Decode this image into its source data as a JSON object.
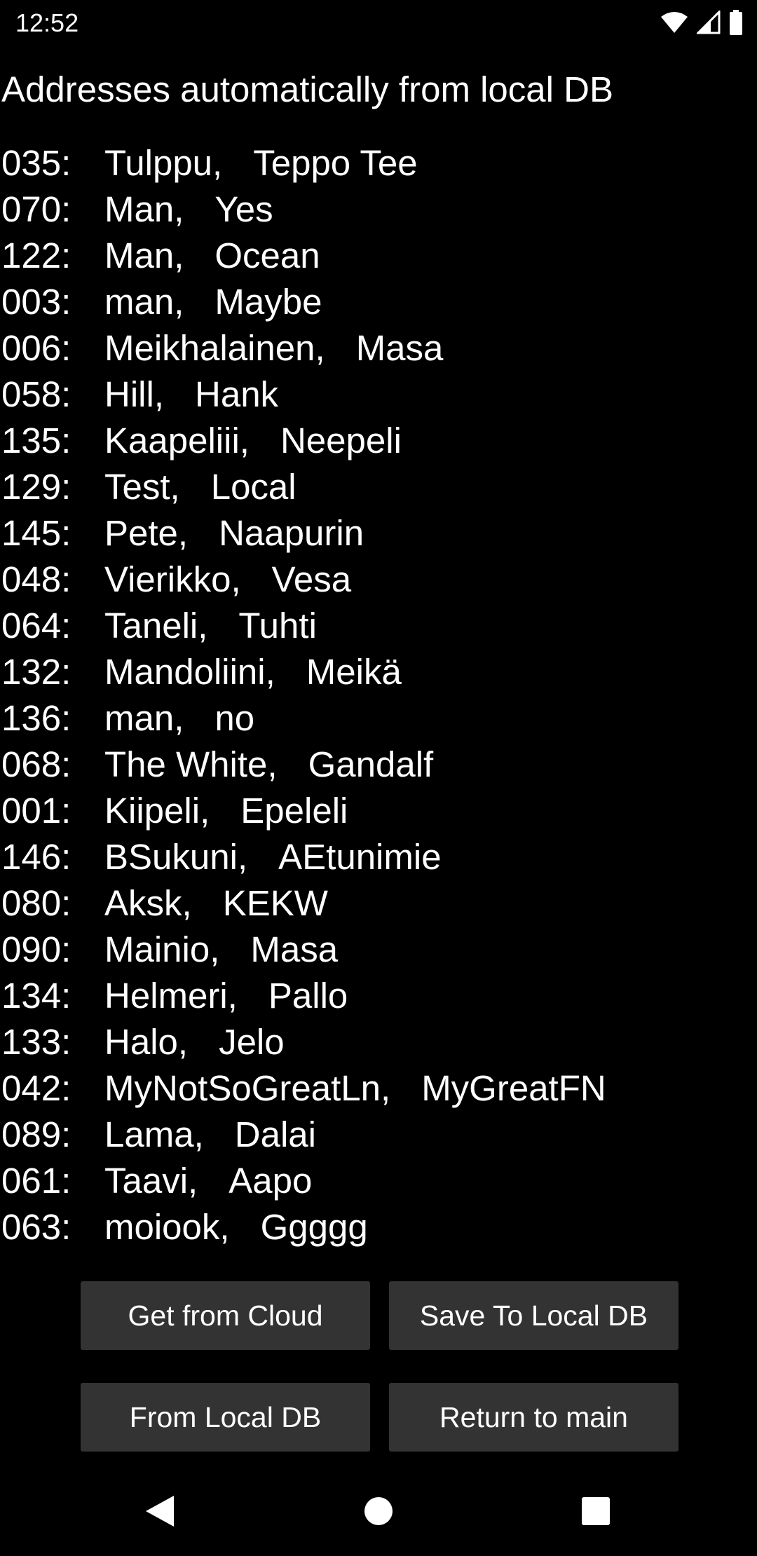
{
  "status_bar": {
    "time": "12:52",
    "icons": [
      "wifi-icon",
      "cell-signal-icon",
      "battery-icon"
    ]
  },
  "title": "Addresses automatically from local DB",
  "addresses": [
    {
      "id": "035:",
      "last": "Tulppu,",
      "first": "Teppo Tee"
    },
    {
      "id": "070:",
      "last": "Man,",
      "first": "Yes"
    },
    {
      "id": "122:",
      "last": "Man,",
      "first": "Ocean"
    },
    {
      "id": "003:",
      "last": "man,",
      "first": "Maybe"
    },
    {
      "id": "006:",
      "last": "Meikhalainen,",
      "first": "Masa"
    },
    {
      "id": "058:",
      "last": "Hill,",
      "first": "Hank"
    },
    {
      "id": "135:",
      "last": "Kaapeliii,",
      "first": "Neepeli"
    },
    {
      "id": "129:",
      "last": "Test,",
      "first": "Local"
    },
    {
      "id": "145:",
      "last": "Pete,",
      "first": "Naapurin"
    },
    {
      "id": "048:",
      "last": "Vierikko,",
      "first": "Vesa"
    },
    {
      "id": "064:",
      "last": "Taneli,",
      "first": "Tuhti"
    },
    {
      "id": "132:",
      "last": "Mandoliini,",
      "first": "Meikä"
    },
    {
      "id": "136:",
      "last": "man,",
      "first": "no"
    },
    {
      "id": "068:",
      "last": "The White,",
      "first": "Gandalf"
    },
    {
      "id": "001:",
      "last": "Kiipeli,",
      "first": "Epeleli"
    },
    {
      "id": "146:",
      "last": "BSukuni,",
      "first": "AEtunimie"
    },
    {
      "id": "080:",
      "last": "Aksk,",
      "first": "KEKW"
    },
    {
      "id": "090:",
      "last": "Mainio,",
      "first": "Masa"
    },
    {
      "id": "134:",
      "last": "Helmeri,",
      "first": "Pallo"
    },
    {
      "id": "133:",
      "last": "Halo,",
      "first": "Jelo"
    },
    {
      "id": "042:",
      "last": "MyNotSoGreatLn,",
      "first": "MyGreatFN"
    },
    {
      "id": "089:",
      "last": "Lama,",
      "first": "Dalai"
    },
    {
      "id": "061:",
      "last": "Taavi,",
      "first": "Aapo"
    },
    {
      "id": "063:",
      "last": "moiook,",
      "first": "Ggggg"
    }
  ],
  "buttons": {
    "get_from_cloud": "Get from Cloud",
    "save_to_local_db": "Save To Local DB",
    "from_local_db": "From Local DB",
    "return_to_main": "Return to main"
  },
  "nav_bar": {
    "icons": [
      "back-icon",
      "home-icon",
      "recents-icon"
    ]
  },
  "colors": {
    "background": "#000000",
    "text": "#ffffff",
    "button_background": "#333333"
  }
}
